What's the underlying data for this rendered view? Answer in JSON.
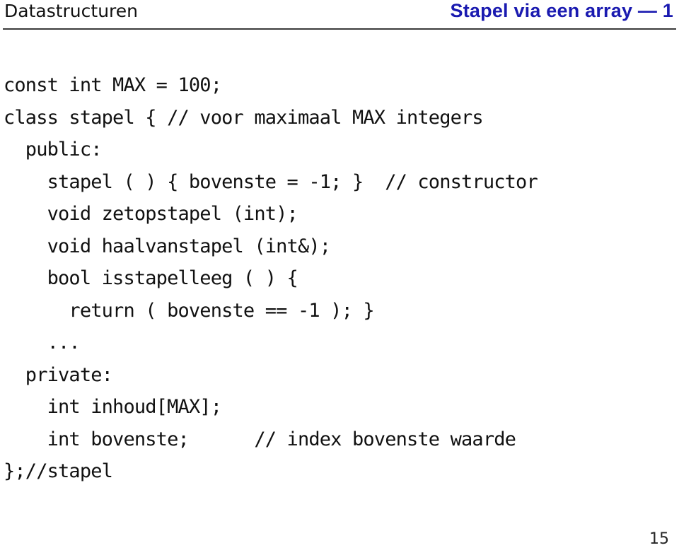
{
  "header": {
    "course_title": "Datastructuren",
    "slide_title": "Stapel via een array — 1",
    "title_color": "#1a1ab0",
    "rule_color": "#3b3b3b"
  },
  "code": {
    "language": "cpp",
    "lines": [
      "const int MAX = 100;",
      "class stapel { // voor maximaal MAX integers",
      "  public:",
      "    stapel ( ) { bovenste = -1; }  // constructor",
      "    void zetopstapel (int);",
      "    void haalvanstapel (int&);",
      "    bool isstapelleeg ( ) {",
      "      return ( bovenste == -1 ); }",
      "    ...",
      "  private:",
      "    int inhoud[MAX];",
      "    int bovenste;      // index bovenste waarde",
      "};//stapel"
    ]
  },
  "footer": {
    "page_number": "15"
  }
}
